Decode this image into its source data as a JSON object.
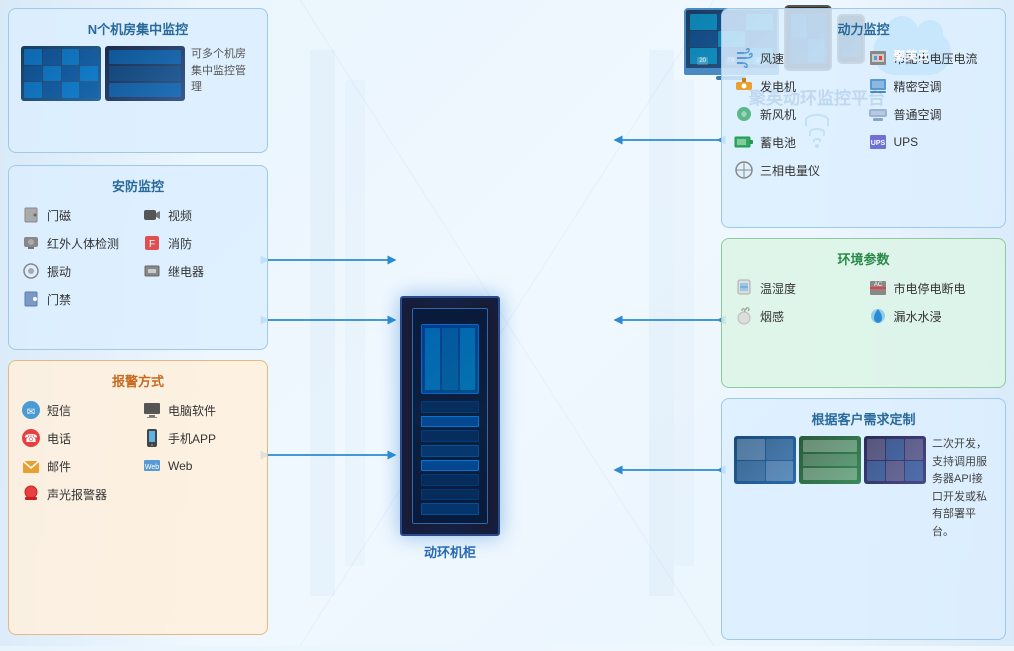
{
  "platform": {
    "title": "聚英动环监控平台",
    "cloud_name": "聚英云",
    "cabinet_label": "动环机柜"
  },
  "top_left_panel": {
    "title": "N个机房集中监控",
    "description_line1": "可多个机房",
    "description_line2": "集中监控管理"
  },
  "mid_left_panel": {
    "title": "安防监控",
    "items": [
      {
        "icon": "door-magnetic-icon",
        "label": "门磁"
      },
      {
        "icon": "video-icon",
        "label": "视频"
      },
      {
        "icon": "infrared-icon",
        "label": "红外人体检测"
      },
      {
        "icon": "fire-icon",
        "label": "消防"
      },
      {
        "icon": "vibration-icon",
        "label": "振动"
      },
      {
        "icon": "relay-icon",
        "label": "继电器"
      },
      {
        "icon": "access-icon",
        "label": "门禁"
      }
    ]
  },
  "bottom_left_panel": {
    "title": "报警方式",
    "items": [
      {
        "icon": "sms-icon",
        "label": "短信"
      },
      {
        "icon": "pc-icon",
        "label": "电脑软件"
      },
      {
        "icon": "phone-icon",
        "label": "电话"
      },
      {
        "icon": "app-icon",
        "label": "手机APP"
      },
      {
        "icon": "email-icon",
        "label": "邮件"
      },
      {
        "icon": "web-icon",
        "label": "Web"
      },
      {
        "icon": "alarm-icon",
        "label": "声光报警器"
      }
    ]
  },
  "top_right_panel": {
    "title": "动力监控",
    "items": [
      {
        "icon": "wind-icon",
        "label": "风速"
      },
      {
        "icon": "power-supply-icon",
        "label": "市配电电压电流"
      },
      {
        "icon": "generator-icon",
        "label": "发电机"
      },
      {
        "icon": "precision-ac-icon",
        "label": "精密空调"
      },
      {
        "icon": "fresh-air-icon",
        "label": "新风机"
      },
      {
        "icon": "normal-ac-icon",
        "label": "普通空调"
      },
      {
        "icon": "battery-icon",
        "label": "蓄电池"
      },
      {
        "icon": "ups-icon",
        "label": "UPS"
      },
      {
        "icon": "three-phase-icon",
        "label": "三相电量仪"
      }
    ]
  },
  "mid_right_panel": {
    "title": "环境参数",
    "items": [
      {
        "icon": "temp-humidity-icon",
        "label": "温湿度"
      },
      {
        "icon": "power-outage-icon",
        "label": "市电停电断电"
      },
      {
        "icon": "smoke-icon",
        "label": "烟感"
      },
      {
        "icon": "water-leak-icon",
        "label": "漏水水浸"
      }
    ]
  },
  "bottom_right_panel": {
    "title": "根据客户需求定制",
    "description": "二次开发，支持调用服务器API接口开发或私有部署平台。"
  }
}
